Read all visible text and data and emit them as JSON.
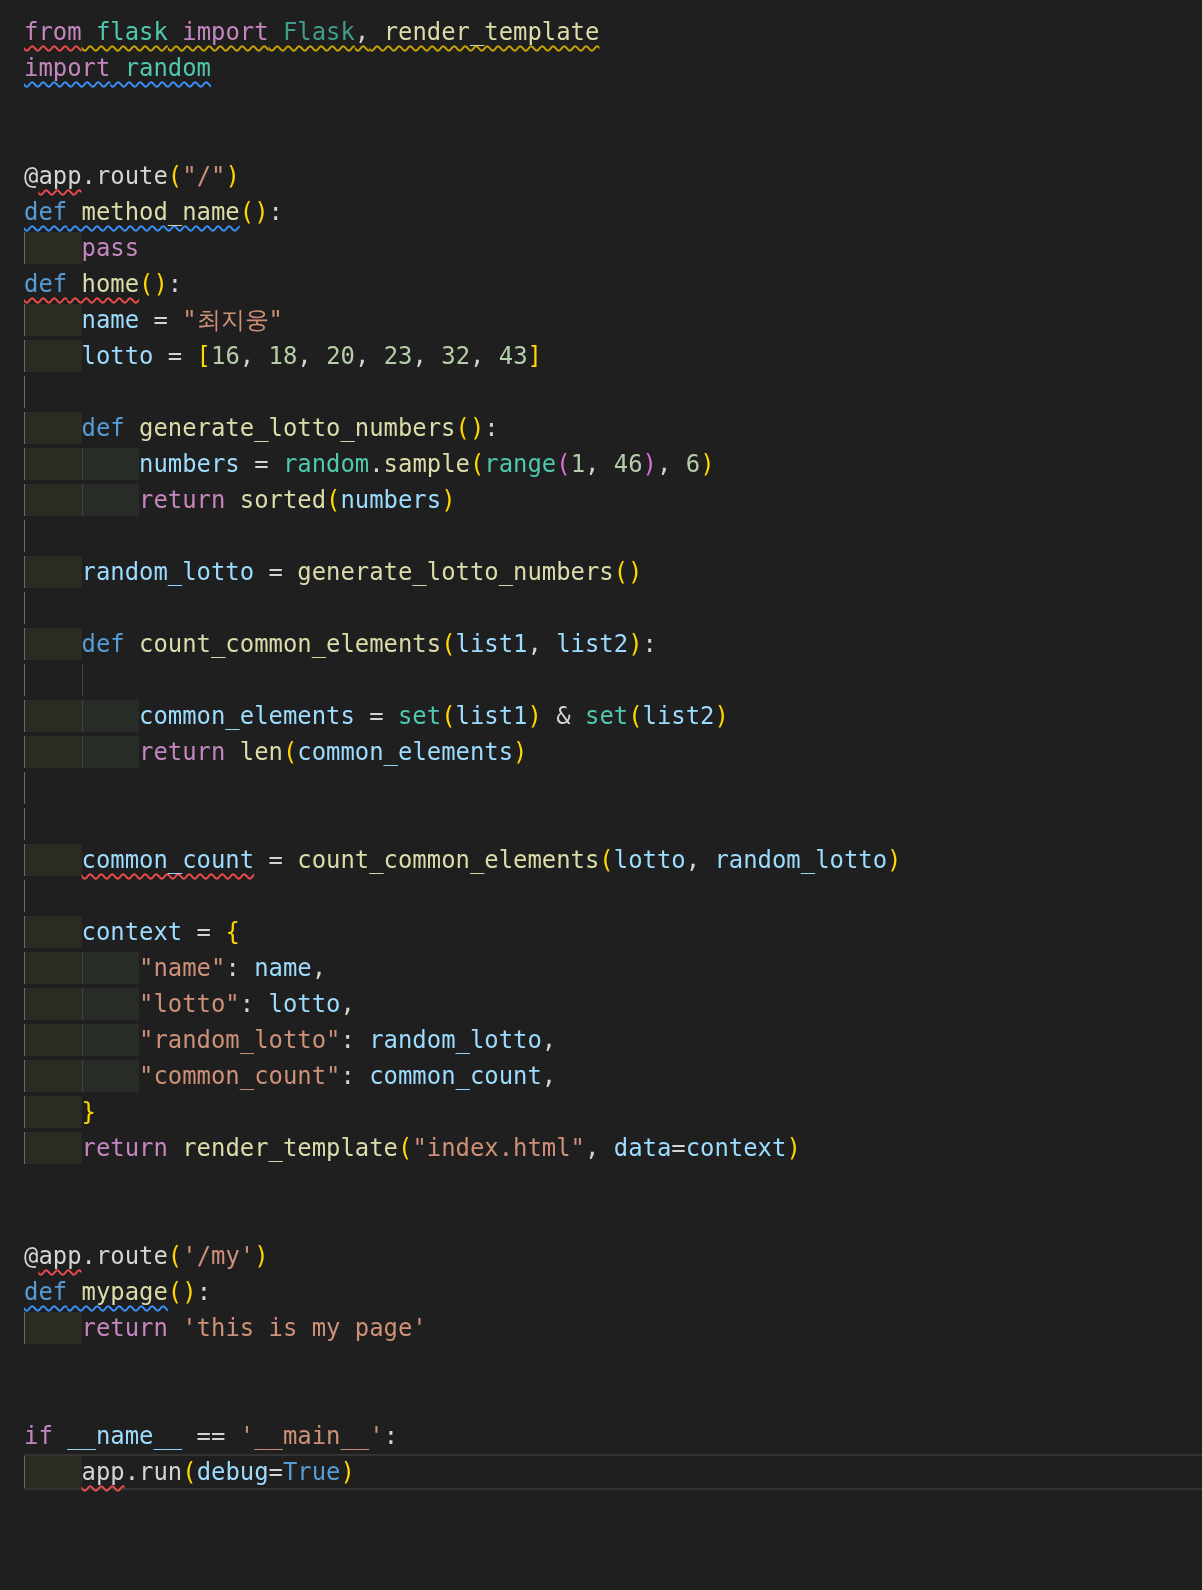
{
  "lines": [
    {
      "kind": "code",
      "tokens": [
        {
          "text": "from",
          "kind": "kw",
          "error": true
        },
        {
          "text": " flask",
          "kind": "mod",
          "warning": true
        },
        {
          "text": " import",
          "kind": "kw",
          "warning": true
        },
        {
          "text": " Flask",
          "kind": "dim",
          "warning": true
        },
        {
          "text": ",",
          "kind": "punc",
          "warning": true
        },
        {
          "text": " render_template",
          "kind": "fn",
          "warning": true
        }
      ]
    },
    {
      "kind": "code",
      "tokens": [
        {
          "text": "import",
          "kind": "kw",
          "info": true
        },
        {
          "text": " random",
          "kind": "mod",
          "info": true
        }
      ]
    },
    {
      "kind": "blank"
    },
    {
      "kind": "blank"
    },
    {
      "kind": "code",
      "tokens": [
        {
          "text": "@",
          "kind": "plain"
        },
        {
          "text": "app",
          "kind": "plain",
          "error": true
        },
        {
          "text": ".route",
          "kind": "plain"
        },
        {
          "text": "(",
          "kind": "b1"
        },
        {
          "text": "\"/\"",
          "kind": "str"
        },
        {
          "text": ")",
          "kind": "b1"
        }
      ]
    },
    {
      "kind": "code",
      "tokens": [
        {
          "text": "def",
          "kind": "def",
          "info": true
        },
        {
          "text": " method_name",
          "kind": "fn",
          "info": true
        },
        {
          "text": "()",
          "kind": "b1"
        },
        {
          "text": ":",
          "kind": "punc"
        }
      ],
      "children": [
        {
          "kind": "code",
          "tokens": [
            {
              "text": "pass",
              "kind": "kw"
            }
          ]
        }
      ]
    },
    {
      "kind": "code",
      "tokens": [
        {
          "text": "def",
          "kind": "def",
          "error": true
        },
        {
          "text": " home",
          "kind": "fn",
          "error": true
        },
        {
          "text": "()",
          "kind": "b1"
        },
        {
          "text": ":",
          "kind": "punc"
        }
      ],
      "children": [
        {
          "kind": "code",
          "tokens": [
            {
              "text": "name",
              "kind": "var"
            },
            {
              "text": " = ",
              "kind": "punc"
            },
            {
              "text": "\"최지웅\"",
              "kind": "str"
            }
          ]
        },
        {
          "kind": "code",
          "tokens": [
            {
              "text": "lotto",
              "kind": "var"
            },
            {
              "text": " = ",
              "kind": "punc"
            },
            {
              "text": "[",
              "kind": "b1"
            },
            {
              "text": "16",
              "kind": "num"
            },
            {
              "text": ", ",
              "kind": "punc"
            },
            {
              "text": "18",
              "kind": "num"
            },
            {
              "text": ", ",
              "kind": "punc"
            },
            {
              "text": "20",
              "kind": "num"
            },
            {
              "text": ", ",
              "kind": "punc"
            },
            {
              "text": "23",
              "kind": "num"
            },
            {
              "text": ", ",
              "kind": "punc"
            },
            {
              "text": "32",
              "kind": "num"
            },
            {
              "text": ", ",
              "kind": "punc"
            },
            {
              "text": "43",
              "kind": "num"
            },
            {
              "text": "]",
              "kind": "b1"
            }
          ]
        },
        {
          "kind": "blank"
        },
        {
          "kind": "code",
          "tokens": [
            {
              "text": "def",
              "kind": "def"
            },
            {
              "text": " generate_lotto_numbers",
              "kind": "fn"
            },
            {
              "text": "()",
              "kind": "b1"
            },
            {
              "text": ":",
              "kind": "punc"
            }
          ],
          "children": [
            {
              "kind": "code",
              "tokens": [
                {
                  "text": "numbers",
                  "kind": "var"
                },
                {
                  "text": " = ",
                  "kind": "punc"
                },
                {
                  "text": "random",
                  "kind": "mod"
                },
                {
                  "text": ".",
                  "kind": "punc"
                },
                {
                  "text": "sample",
                  "kind": "fn"
                },
                {
                  "text": "(",
                  "kind": "b1"
                },
                {
                  "text": "range",
                  "kind": "mod"
                },
                {
                  "text": "(",
                  "kind": "b2"
                },
                {
                  "text": "1",
                  "kind": "num"
                },
                {
                  "text": ", ",
                  "kind": "punc"
                },
                {
                  "text": "46",
                  "kind": "num"
                },
                {
                  "text": ")",
                  "kind": "b2"
                },
                {
                  "text": ", ",
                  "kind": "punc"
                },
                {
                  "text": "6",
                  "kind": "num"
                },
                {
                  "text": ")",
                  "kind": "b1"
                }
              ]
            },
            {
              "kind": "code",
              "tokens": [
                {
                  "text": "return",
                  "kind": "kw"
                },
                {
                  "text": " sorted",
                  "kind": "fn"
                },
                {
                  "text": "(",
                  "kind": "b1"
                },
                {
                  "text": "numbers",
                  "kind": "var"
                },
                {
                  "text": ")",
                  "kind": "b1"
                }
              ]
            }
          ]
        },
        {
          "kind": "blank"
        },
        {
          "kind": "code",
          "tokens": [
            {
              "text": "random_lotto",
              "kind": "var"
            },
            {
              "text": " = ",
              "kind": "punc"
            },
            {
              "text": "generate_lotto_numbers",
              "kind": "fn"
            },
            {
              "text": "()",
              "kind": "b1"
            }
          ]
        },
        {
          "kind": "blank"
        },
        {
          "kind": "code",
          "tokens": [
            {
              "text": "def",
              "kind": "def"
            },
            {
              "text": " count_common_elements",
              "kind": "fn"
            },
            {
              "text": "(",
              "kind": "b1"
            },
            {
              "text": "list1",
              "kind": "var"
            },
            {
              "text": ", ",
              "kind": "punc"
            },
            {
              "text": "list2",
              "kind": "var"
            },
            {
              "text": ")",
              "kind": "b1"
            },
            {
              "text": ":",
              "kind": "punc"
            }
          ],
          "children": [
            {
              "kind": "blank"
            },
            {
              "kind": "code",
              "tokens": [
                {
                  "text": "common_elements",
                  "kind": "var"
                },
                {
                  "text": " = ",
                  "kind": "punc"
                },
                {
                  "text": "set",
                  "kind": "mod"
                },
                {
                  "text": "(",
                  "kind": "b1"
                },
                {
                  "text": "list1",
                  "kind": "var"
                },
                {
                  "text": ")",
                  "kind": "b1"
                },
                {
                  "text": " & ",
                  "kind": "punc"
                },
                {
                  "text": "set",
                  "kind": "mod"
                },
                {
                  "text": "(",
                  "kind": "b1"
                },
                {
                  "text": "list2",
                  "kind": "var"
                },
                {
                  "text": ")",
                  "kind": "b1"
                }
              ]
            },
            {
              "kind": "code",
              "tokens": [
                {
                  "text": "return",
                  "kind": "kw"
                },
                {
                  "text": " len",
                  "kind": "fn"
                },
                {
                  "text": "(",
                  "kind": "b1"
                },
                {
                  "text": "common_elements",
                  "kind": "var"
                },
                {
                  "text": ")",
                  "kind": "b1"
                }
              ]
            }
          ]
        },
        {
          "kind": "blank"
        },
        {
          "kind": "blank"
        },
        {
          "kind": "code",
          "tokens": [
            {
              "text": "common_count",
              "kind": "var",
              "error": true
            },
            {
              "text": " = ",
              "kind": "punc"
            },
            {
              "text": "count_common_elements",
              "kind": "fn"
            },
            {
              "text": "(",
              "kind": "b1"
            },
            {
              "text": "lotto",
              "kind": "var"
            },
            {
              "text": ", ",
              "kind": "punc"
            },
            {
              "text": "random_lotto",
              "kind": "var"
            },
            {
              "text": ")",
              "kind": "b1"
            }
          ]
        },
        {
          "kind": "blank"
        },
        {
          "kind": "code",
          "tokens": [
            {
              "text": "context",
              "kind": "var"
            },
            {
              "text": " = ",
              "kind": "punc"
            },
            {
              "text": "{",
              "kind": "b1"
            }
          ],
          "children": [
            {
              "kind": "code",
              "tokens": [
                {
                  "text": "\"name\"",
                  "kind": "str"
                },
                {
                  "text": ": ",
                  "kind": "punc"
                },
                {
                  "text": "name",
                  "kind": "var"
                },
                {
                  "text": ",",
                  "kind": "punc"
                }
              ]
            },
            {
              "kind": "code",
              "tokens": [
                {
                  "text": "\"lotto\"",
                  "kind": "str"
                },
                {
                  "text": ": ",
                  "kind": "punc"
                },
                {
                  "text": "lotto",
                  "kind": "var"
                },
                {
                  "text": ",",
                  "kind": "punc"
                }
              ]
            },
            {
              "kind": "code",
              "tokens": [
                {
                  "text": "\"random_lotto\"",
                  "kind": "str"
                },
                {
                  "text": ": ",
                  "kind": "punc"
                },
                {
                  "text": "random_lotto",
                  "kind": "var"
                },
                {
                  "text": ",",
                  "kind": "punc"
                }
              ]
            },
            {
              "kind": "code",
              "tokens": [
                {
                  "text": "\"common_count\"",
                  "kind": "str"
                },
                {
                  "text": ": ",
                  "kind": "punc"
                },
                {
                  "text": "common_count",
                  "kind": "var"
                },
                {
                  "text": ",",
                  "kind": "punc"
                }
              ]
            }
          ]
        },
        {
          "kind": "code",
          "tokens": [
            {
              "text": "}",
              "kind": "b1"
            }
          ]
        },
        {
          "kind": "code",
          "tokens": [
            {
              "text": "return",
              "kind": "kw"
            },
            {
              "text": " render_template",
              "kind": "fn"
            },
            {
              "text": "(",
              "kind": "b1"
            },
            {
              "text": "\"index.html\"",
              "kind": "str"
            },
            {
              "text": ", ",
              "kind": "punc"
            },
            {
              "text": "data",
              "kind": "var"
            },
            {
              "text": "=",
              "kind": "punc"
            },
            {
              "text": "context",
              "kind": "var"
            },
            {
              "text": ")",
              "kind": "b1"
            }
          ]
        }
      ]
    },
    {
      "kind": "blank"
    },
    {
      "kind": "blank"
    },
    {
      "kind": "code",
      "tokens": [
        {
          "text": "@",
          "kind": "plain"
        },
        {
          "text": "app",
          "kind": "plain",
          "error": true
        },
        {
          "text": ".route",
          "kind": "plain"
        },
        {
          "text": "(",
          "kind": "b1"
        },
        {
          "text": "'/my'",
          "kind": "str"
        },
        {
          "text": ")",
          "kind": "b1"
        }
      ]
    },
    {
      "kind": "code",
      "tokens": [
        {
          "text": "def",
          "kind": "def",
          "info": true
        },
        {
          "text": " mypage",
          "kind": "fn",
          "info": true
        },
        {
          "text": "()",
          "kind": "b1"
        },
        {
          "text": ":",
          "kind": "punc"
        }
      ],
      "children": [
        {
          "kind": "code",
          "tokens": [
            {
              "text": "return",
              "kind": "kw"
            },
            {
              "text": " 'this is my page'",
              "kind": "str"
            }
          ]
        }
      ]
    },
    {
      "kind": "blank"
    },
    {
      "kind": "blank"
    },
    {
      "kind": "code",
      "tokens": [
        {
          "text": "if",
          "kind": "kw"
        },
        {
          "text": " __name__",
          "kind": "var"
        },
        {
          "text": " == ",
          "kind": "punc"
        },
        {
          "text": "'__main__'",
          "kind": "str"
        },
        {
          "text": ":",
          "kind": "punc"
        }
      ],
      "children": [
        {
          "kind": "code",
          "current": true,
          "tokens": [
            {
              "text": "app",
              "kind": "plain",
              "error": true
            },
            {
              "text": ".run",
              "kind": "plain"
            },
            {
              "text": "(",
              "kind": "b1"
            },
            {
              "text": "debug",
              "kind": "var"
            },
            {
              "text": "=",
              "kind": "punc"
            },
            {
              "text": "True",
              "kind": "def"
            },
            {
              "text": ")",
              "kind": "b1"
            }
          ]
        }
      ]
    }
  ]
}
